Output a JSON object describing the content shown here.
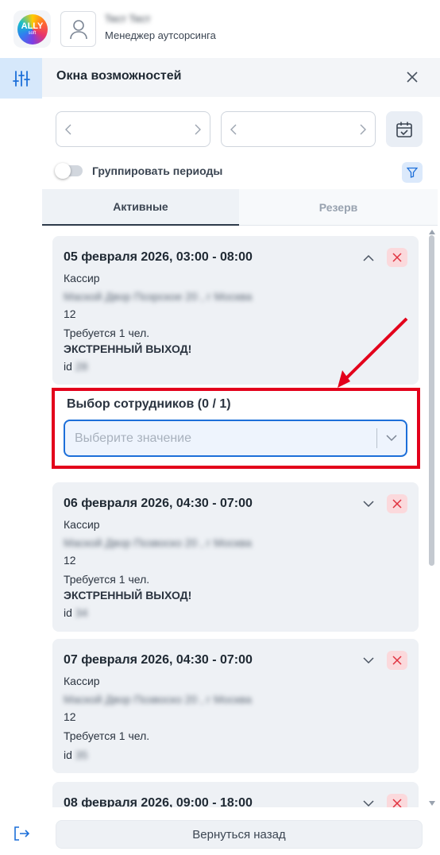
{
  "header": {
    "logo_text": "ALLY",
    "logo_sub": "soft",
    "user_name": "Тест Тест",
    "user_role": "Менеджер аутсорсинга"
  },
  "panel": {
    "title": "Окна возможностей",
    "group_label": "Группировать периоды",
    "tabs": [
      {
        "label": "Активные",
        "active": true
      },
      {
        "label": "Резерв",
        "active": false
      }
    ]
  },
  "cards": [
    {
      "title": "05 февраля 2026, 03:00 - 08:00",
      "role": "Кассир",
      "address": "Маской Двор Позрское 20 , г Москва",
      "number": "12",
      "required": "Требуется 1 чел.",
      "urgent": "ЭКСТРЕННЫЙ ВЫХОД!",
      "id_label": "id",
      "id_value": "28",
      "expanded": true
    },
    {
      "title": "06 февраля 2026, 04:30 - 07:00",
      "role": "Кассир",
      "address": "Маской Двор Позвоско 20 , г Москва",
      "number": "12",
      "required": "Требуется 1 чел.",
      "urgent": "ЭКСТРЕННЫЙ ВЫХОД!",
      "id_label": "id",
      "id_value": "34",
      "expanded": false
    },
    {
      "title": "07 февраля 2026, 04:30 - 07:00",
      "role": "Кассир",
      "address": "Маской Двор Позвоско 20 , г Москва",
      "number": "12",
      "required": "Требуется 1 чел.",
      "id_label": "id",
      "id_value": "35",
      "expanded": false
    },
    {
      "title": "08 февраля 2026, 09:00 - 18:00",
      "expanded": false
    }
  ],
  "employee_select": {
    "label": "Выбор сотрудников (0 / 1)",
    "placeholder": "Выберите значение"
  },
  "footer": {
    "back_label": "Вернуться назад"
  },
  "colors": {
    "accent": "#1c6fd9",
    "highlight_red": "#e3001b",
    "card_bg": "#eef1f5",
    "close_btn_bg": "#fbd9dc"
  }
}
